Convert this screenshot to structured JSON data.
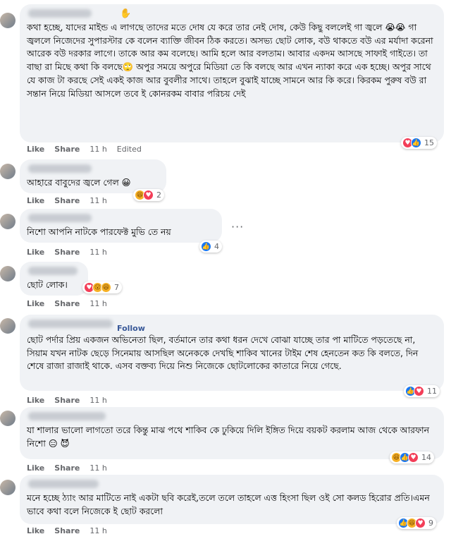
{
  "actions": {
    "like": "Like",
    "share": "Share",
    "edited": "Edited"
  },
  "comments": [
    {
      "text": "কথা হচ্ছে, যাদের মাইন্ড এ লাগছে তাদের মতে দোষ যে করে তার নেই দোষ, কেউ কিছু বললেই গা জ্বলে 😭😭 গা জ্বললে নিজেদের সুপারস্টার কে বলেন ব্যাক্তি জীবন ঠিক করতে। অসভ্য ছোট লোক, বউ থাকতে বউ এর মর্যাদা করেনা আরেক বউ দরকার লাগে। তাকে আর কম বলেছে। আমি হলে আর বলতাম। আবার একদম আসছে সাফাই গাইতে। তা বাছা রা মিছে কথা কি বলছে🙄 অপুর সময়ে অপুরে মিডিয়া তে কি বলছে আর এখন ন্যাকা করে এক হচ্ছে। অপুর সাথে যে কাজ টা করছে সেই একই কাজ আর বুবলীর সাথে। তাহলে বুঝাই যাচ্ছে সামনে আর কি করে। কিরকম পুরুষ বউ রা সন্তান নিয়ে মিডিয়া আসলে তবে ই কোনরকম বাবার পরিচয় দেই",
      "time": "11 h",
      "reaction_count": "15",
      "reactions": [
        "love",
        "like"
      ]
    },
    {
      "text": "আহারে বাবুদের জ্বলে গেল 😀",
      "time": "11 h",
      "reaction_count": "2",
      "reactions": [
        "haha",
        "love"
      ]
    },
    {
      "text": "নিশো আপনি নাটকে পারফেক্ট মুভি তে নয়",
      "time": "11 h",
      "reaction_count": "4",
      "reactions": [
        "like"
      ]
    },
    {
      "text": "ছোট লোক।",
      "time": "11 h",
      "reaction_count": "7",
      "reactions": [
        "love",
        "wow",
        "haha"
      ]
    },
    {
      "follow": "Follow",
      "text": "ছোট পর্দার প্রিয় একজন অভিনেতা ছিল, বর্তমানে তার কথা ধরন দেখে বোঝা যাচ্ছে তার পা মাটিতে পড়তেছে না, সিয়াম যখন নাটক ছেড়ে সিনেমায় আসছিল অনেককে দেখছি শাকিব খানের টাইম শেষ হেনতেন কত কি বলতে, দিন শেষে রাজা রাজাই থাকে. এসব বক্তব্য দিয়ে নিশু নিজেকে ছোটলোকের কাতারে নিয়ে গেছে.",
      "time": "11 h",
      "reaction_count": "11",
      "reactions": [
        "like",
        "love"
      ]
    },
    {
      "text": "যা শালার ভালো লাগতো তরে কিন্তু মাঝ পথে শাকিব কে ঢুকিয়ে দিলি ইঙ্গিত দিয়ে বয়কট করলাম আজ থেকে আরফান নিশো 😑 😈",
      "time": "11 h",
      "reaction_count": "14",
      "reactions": [
        "haha",
        "like",
        "love"
      ]
    },
    {
      "text": "মনে হচ্ছে ঠ্যাং আর মাটিতে নাই একটা ছবি করেই,তলে তলে তাহলে এত্ত হিংসা ছিল ওই সো কলড হিরোর প্রতি।এমন ভাবে কথা বলে নিজেকে ই ছোট করলো",
      "time": "11 h",
      "reaction_count": "9",
      "reactions": [
        "like",
        "haha",
        "love"
      ]
    }
  ],
  "icons": {
    "like": "thumbs-up-icon",
    "love": "heart-icon",
    "haha": "laughing-face-icon",
    "wow": "surprised-face-icon",
    "wave": "waving-hand-icon",
    "more": "more-options-icon"
  }
}
